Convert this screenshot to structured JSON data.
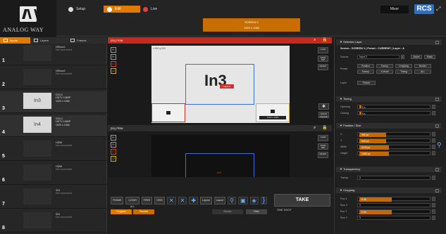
{
  "header": {
    "logo_text": "ANALOG WAY",
    "modes": [
      {
        "label": "Setup"
      },
      {
        "label": "Edit"
      },
      {
        "label": "Live"
      }
    ],
    "screen_title": "SCREEN 1",
    "screen_res": "1920 x 1080",
    "mixer_label": "Mixer",
    "rcs_label": "RCS"
  },
  "left": {
    "tabs": [
      "Inputs",
      "Layers",
      "Frames"
    ],
    "inputs": [
      {
        "num": "1",
        "name": "NShow1",
        "thumb": "",
        "res": "",
        "rate": "",
        "extra": "Not connected"
      },
      {
        "num": "2",
        "name": "NShow2",
        "thumb": "",
        "res": "",
        "rate": "",
        "extra": "Not connected"
      },
      {
        "num": "3",
        "name": "DVI-D",
        "thumb": "In3",
        "res": "HDTV 1080P",
        "rate": "1920 x 1080",
        "extra": ""
      },
      {
        "num": "4",
        "name": "DVI-D",
        "thumb": "In4",
        "res": "HDTV 1080P",
        "rate": "1920 x 1080",
        "extra": ""
      },
      {
        "num": "5",
        "name": "HDMI",
        "thumb": "",
        "res": "",
        "rate": "",
        "extra": "Not connected"
      },
      {
        "num": "6",
        "name": "HDMI",
        "thumb": "",
        "res": "",
        "rate": "",
        "extra": "Not connected"
      },
      {
        "num": "7",
        "name": "SDI",
        "thumb": "",
        "res": "",
        "rate": "",
        "extra": "Not connected"
      },
      {
        "num": "8",
        "name": "SDI",
        "thumb": "",
        "res": "",
        "rate": "",
        "extra": "Not connected"
      }
    ]
  },
  "center": {
    "pgm_title": "[S1] PGM",
    "pvw_title": "[S1] PRW",
    "pgm_coords": "x:960 y:540",
    "pgm_layer_label": "In3",
    "pgm_layer_sub": "Layer A",
    "pvw_layer_label": "In3",
    "pgm_small_label": "1920 x 1080",
    "left_strip": [
      "Fr",
      "Fr",
      "L1",
      "L2"
    ],
    "right_strip_pgm": [
      "LOAD",
      "SAVE MM",
      "RESET"
    ],
    "right_strip_pvw": [
      "LOAD",
      "SAVE MM",
      "RESET"
    ],
    "quick_frame": "QUICK FRAME"
  },
  "bottom": {
    "tools": [
      "FRAME",
      "CLEAR ALL",
      "FREE",
      "GRID",
      "Layout",
      "Layout"
    ],
    "take_label": "TAKE",
    "oneshot_label": "ONE SHOT",
    "program_label": "Program",
    "preview_label": "Preview",
    "mosaic_label": "Mosaic",
    "filter_label": "Filter"
  },
  "right": {
    "selected_layer": {
      "title": "Selected Layer",
      "path": "Screen : SCREEN 1  |  Preset : CURRENT  |  Layer : A",
      "source_label": "Source",
      "source_value": "Input 3",
      "source_btns": [
        "Active",
        "Mask"
      ],
      "preset_label": "Preset",
      "preset_btns": [
        "Position",
        "Transp.",
        "Cropping",
        "Border",
        "Transp.",
        "X Mode",
        "Timing",
        "ALL"
      ],
      "layer_label": "Layer",
      "layer_value": "Freeze"
    },
    "timing": {
      "title": "Timing",
      "opening_label": "Opening",
      "opening_value": "5 s",
      "closing_label": "Closing",
      "closing_value": "5 s"
    },
    "position": {
      "title": "Position / Size",
      "rows": [
        {
          "label": "X",
          "value": "960 px"
        },
        {
          "label": "Y",
          "value": "540 px"
        },
        {
          "label": "Width",
          "value": "1120 px"
        },
        {
          "label": "Height",
          "value": "1080 px"
        }
      ]
    },
    "transparency": {
      "title": "Transparency",
      "label": "Transp.",
      "value": "0"
    },
    "cropping": {
      "title": "Cropping",
      "rows": [
        {
          "label": "Pos X",
          "value": "0.00"
        },
        {
          "label": "Size X",
          "value": "0"
        },
        {
          "label": "Pos Y",
          "value": "0.00"
        },
        {
          "label": "Size Y",
          "value": "0"
        }
      ]
    }
  }
}
